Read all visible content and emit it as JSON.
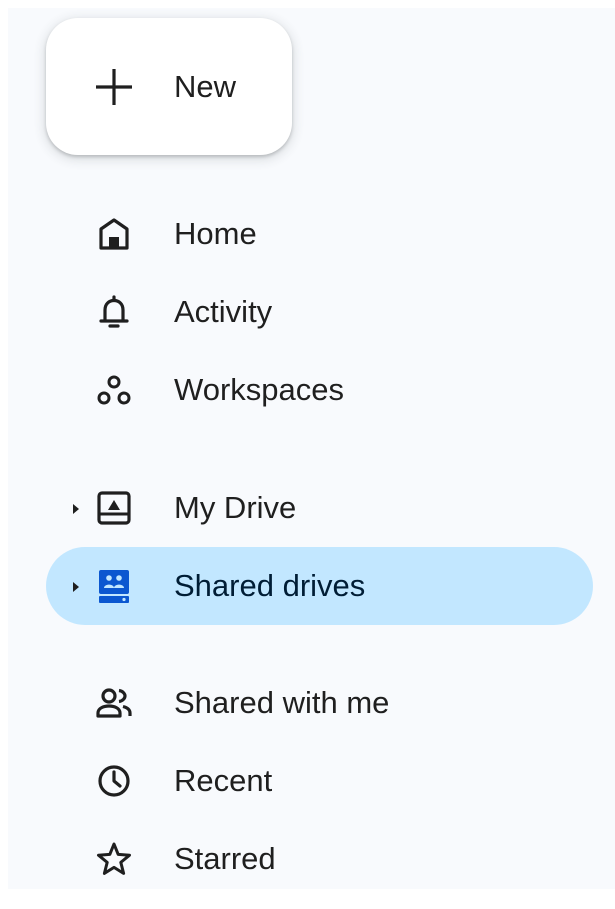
{
  "colors": {
    "panel_background": "#f8fafd",
    "selected_background": "#c2e7ff",
    "selected_text": "#001d35",
    "selected_icon": "#0b57d0",
    "text": "#1f1f1f"
  },
  "new_button": {
    "label": "New",
    "icon": "plus-icon"
  },
  "nav": {
    "home": {
      "label": "Home",
      "icon": "home-icon"
    },
    "activity": {
      "label": "Activity",
      "icon": "bell-icon"
    },
    "workspaces": {
      "label": "Workspaces",
      "icon": "workspaces-icon"
    },
    "my_drive": {
      "label": "My Drive",
      "icon": "drive-icon",
      "expandable": true
    },
    "shared_drives": {
      "label": "Shared drives",
      "icon": "shared-drives-icon",
      "expandable": true,
      "selected": true
    },
    "shared_with_me": {
      "label": "Shared with me",
      "icon": "people-icon"
    },
    "recent": {
      "label": "Recent",
      "icon": "clock-icon"
    },
    "starred": {
      "label": "Starred",
      "icon": "star-icon"
    }
  }
}
